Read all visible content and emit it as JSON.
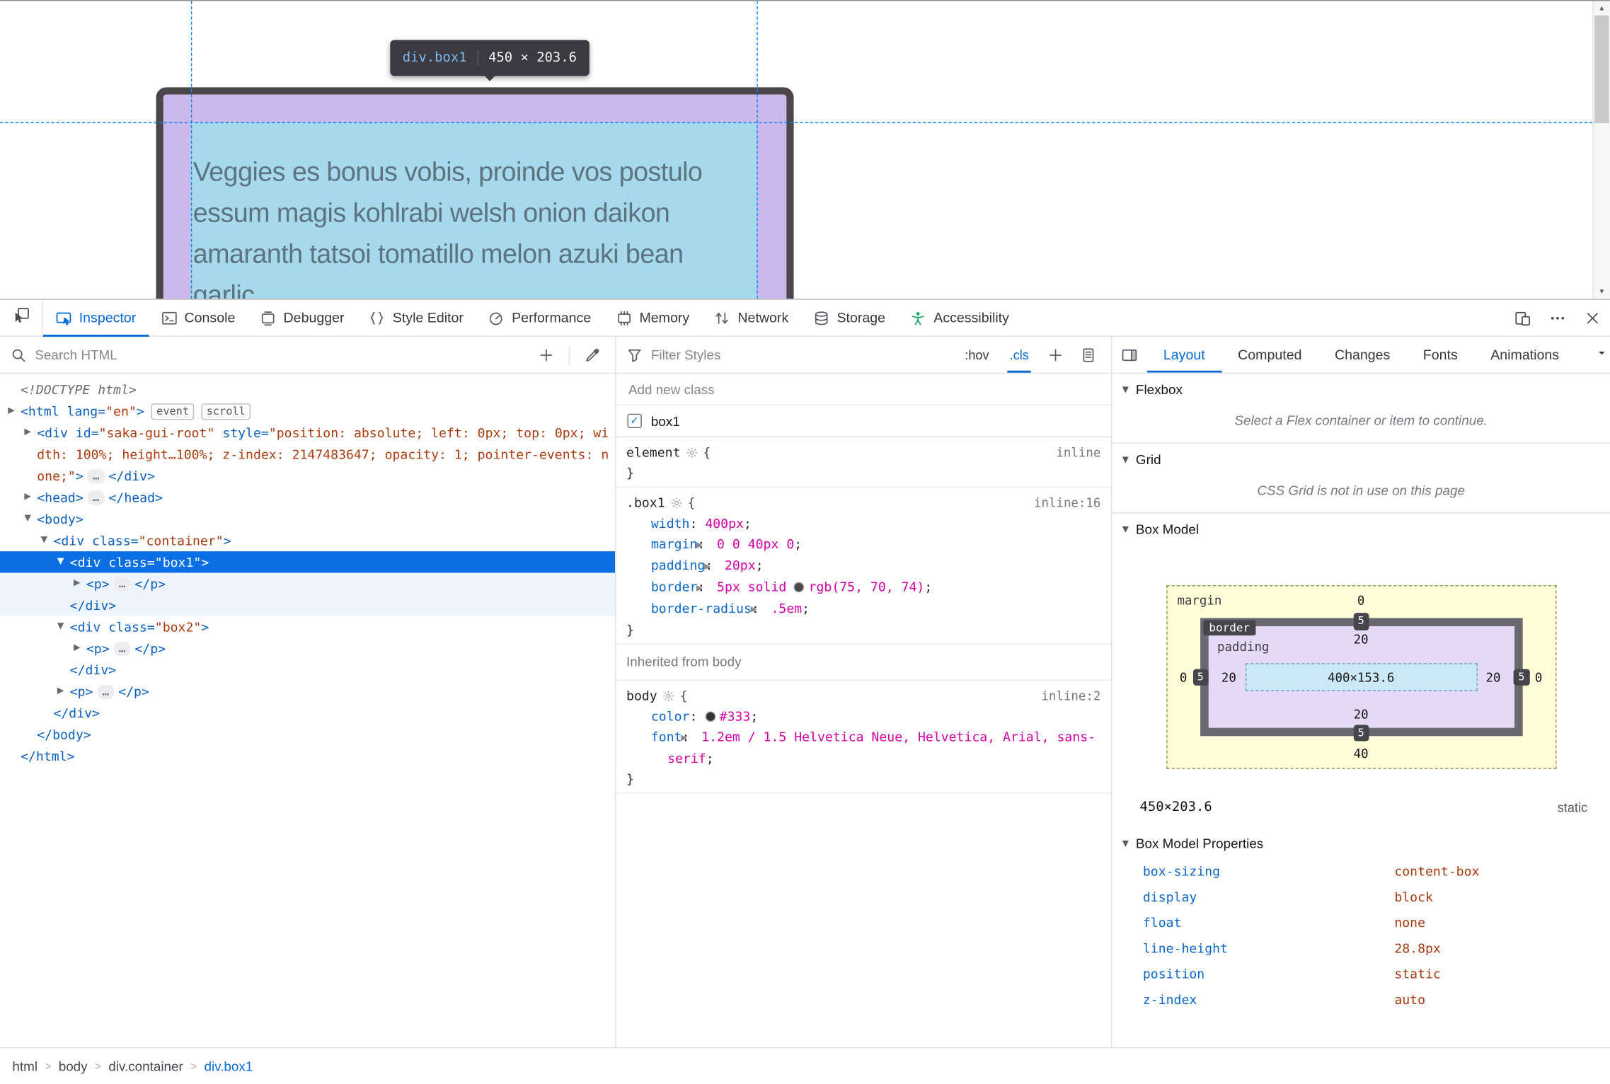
{
  "page_view": {
    "tooltip": {
      "selector": "div.box1",
      "dimensions": "450 × 203.6"
    },
    "box_text_lines": [
      "Veggies es bonus vobis, proinde vos postulo",
      "essum magis kohlrabi welsh onion daikon",
      "amaranth tatsoi tomatillo melon azuki bean",
      "garlic."
    ]
  },
  "devtools": {
    "tabs": [
      {
        "label": "Inspector",
        "icon": "inspector",
        "active": true
      },
      {
        "label": "Console",
        "icon": "console"
      },
      {
        "label": "Debugger",
        "icon": "debugger"
      },
      {
        "label": "Style Editor",
        "icon": "style-editor"
      },
      {
        "label": "Performance",
        "icon": "performance"
      },
      {
        "label": "Memory",
        "icon": "memory"
      },
      {
        "label": "Network",
        "icon": "network"
      },
      {
        "label": "Storage",
        "icon": "storage"
      },
      {
        "label": "Accessibility",
        "icon": "accessibility",
        "icon_color": "#12a457"
      }
    ],
    "controls": [
      {
        "icon": "responsive",
        "name": "responsive-design-mode-button"
      },
      {
        "icon": "meatball",
        "name": "devtools-menu-button"
      },
      {
        "icon": "close",
        "name": "close-devtools-button"
      }
    ],
    "accent_color": "#0768d9"
  },
  "markup": {
    "search_placeholder": "Search HTML",
    "lines": [
      {
        "indent": 0,
        "segments": [
          {
            "t": "doctype",
            "x": "<!DOCTYPE html>"
          }
        ]
      },
      {
        "indent": 0,
        "arrow": "right",
        "segments": [
          {
            "t": "tag",
            "x": "<html lang="
          },
          {
            "t": "val",
            "x": "\"en\""
          },
          {
            "t": "tag",
            "x": ">"
          },
          {
            "t": "badge",
            "x": "event"
          },
          {
            "t": "badge",
            "x": "scroll"
          }
        ]
      },
      {
        "indent": 1,
        "arrow": "right",
        "segments": [
          {
            "t": "tag",
            "x": "<div id="
          },
          {
            "t": "val",
            "x": "\"saka-gui-root\""
          },
          {
            "t": "tag",
            "x": " style="
          },
          {
            "t": "val",
            "x": "\"position: absolute; left: 0px; top: 0px; width: 100%; height…100%; z-index: 2147483647; opacity: 1; pointer-events: none;\""
          },
          {
            "t": "tag",
            "x": ">"
          },
          {
            "t": "ellipsis",
            "x": "…"
          },
          {
            "t": "tag",
            "x": "</div>"
          }
        ]
      },
      {
        "indent": 1,
        "arrow": "right",
        "segments": [
          {
            "t": "tag",
            "x": "<head>"
          },
          {
            "t": "ellipsis",
            "x": "…"
          },
          {
            "t": "tag",
            "x": "</head>"
          }
        ]
      },
      {
        "indent": 1,
        "arrow": "down",
        "segments": [
          {
            "t": "tag",
            "x": "<body>"
          }
        ]
      },
      {
        "indent": 2,
        "arrow": "down",
        "segments": [
          {
            "t": "tag",
            "x": "<div class="
          },
          {
            "t": "val",
            "x": "\"container\""
          },
          {
            "t": "tag",
            "x": ">"
          }
        ]
      },
      {
        "indent": 3,
        "arrow": "down",
        "selected": true,
        "segments": [
          {
            "t": "tag",
            "x": "<div class="
          },
          {
            "t": "val",
            "x": "\"box1\""
          },
          {
            "t": "tag",
            "x": ">"
          }
        ]
      },
      {
        "indent": 4,
        "arrow": "right",
        "tint": true,
        "segments": [
          {
            "t": "tag",
            "x": "<p>"
          },
          {
            "t": "ellipsis",
            "x": "…"
          },
          {
            "t": "tag",
            "x": "</p>"
          }
        ]
      },
      {
        "indent": 3,
        "tint": true,
        "segments": [
          {
            "t": "tag",
            "x": "</div>"
          }
        ]
      },
      {
        "indent": 3,
        "arrow": "down",
        "segments": [
          {
            "t": "tag",
            "x": "<div class="
          },
          {
            "t": "val",
            "x": "\"box2\""
          },
          {
            "t": "tag",
            "x": ">"
          }
        ]
      },
      {
        "indent": 4,
        "arrow": "right",
        "segments": [
          {
            "t": "tag",
            "x": "<p>"
          },
          {
            "t": "ellipsis",
            "x": "…"
          },
          {
            "t": "tag",
            "x": "</p>"
          }
        ]
      },
      {
        "indent": 3,
        "segments": [
          {
            "t": "tag",
            "x": "</div>"
          }
        ]
      },
      {
        "indent": 3,
        "arrow": "right",
        "segments": [
          {
            "t": "tag",
            "x": "<p>"
          },
          {
            "t": "ellipsis",
            "x": "…"
          },
          {
            "t": "tag",
            "x": "</p>"
          }
        ]
      },
      {
        "indent": 2,
        "segments": [
          {
            "t": "tag",
            "x": "</div>"
          }
        ]
      },
      {
        "indent": 1,
        "segments": [
          {
            "t": "tag",
            "x": "</body>"
          }
        ]
      },
      {
        "indent": 0,
        "segments": [
          {
            "t": "tag",
            "x": "</html>"
          }
        ]
      }
    ],
    "breadcrumbs": [
      {
        "label": "html"
      },
      {
        "label": "body"
      },
      {
        "label": "div.container"
      },
      {
        "label": "div.box1",
        "active": true
      }
    ]
  },
  "rules": {
    "filter_placeholder": "Filter Styles",
    "hov": ":hov",
    "cls": ".cls",
    "class_panel": {
      "add_placeholder": "Add new class",
      "classes": [
        {
          "name": "box1",
          "checked": true
        }
      ]
    },
    "sections": [
      {
        "type": "rule",
        "selector": "element",
        "location": "inline",
        "props": []
      },
      {
        "type": "rule",
        "selector": ".box1",
        "location": "inline:16",
        "props": [
          {
            "name": "width",
            "text": "400px"
          },
          {
            "name": "margin",
            "arrow": true,
            "text": "0 0 40px 0"
          },
          {
            "name": "padding",
            "arrow": true,
            "text": "20px"
          },
          {
            "name": "border",
            "arrow": true,
            "pre": "5px solid ",
            "swatch": "#4b464a",
            "text": "rgb(75, 70, 74)"
          },
          {
            "name": "border-radius",
            "arrow": true,
            "text": ".5em"
          }
        ]
      },
      {
        "type": "header",
        "text": "Inherited from body"
      },
      {
        "type": "rule",
        "selector": "body",
        "location": "inline:2",
        "props": [
          {
            "name": "color",
            "swatch": "#333333",
            "text": "#333"
          },
          {
            "name": "font",
            "arrow": true,
            "text": "1.2em / 1.5 Helvetica Neue, Helvetica, Arial, sans-serif"
          }
        ]
      }
    ]
  },
  "layout": {
    "tabs": [
      "Layout",
      "Computed",
      "Changes",
      "Fonts",
      "Animations"
    ],
    "flexbox": {
      "title": "Flexbox",
      "message": "Select a Flex container or item to continue."
    },
    "grid": {
      "title": "Grid",
      "message": "CSS Grid is not in use on this page"
    },
    "box_model": {
      "title": "Box Model",
      "labels": {
        "margin": "margin",
        "border": "border",
        "padding": "padding"
      },
      "content": "400×153.6",
      "margin": {
        "top": "0",
        "right": "0",
        "bottom": "40",
        "left": "0"
      },
      "border": {
        "top": "5",
        "right": "5",
        "bottom": "5",
        "left": "5"
      },
      "padding": {
        "top": "20",
        "right": "20",
        "bottom": "20",
        "left": "20"
      },
      "element_size": "450×203.6",
      "position": "static"
    },
    "properties": {
      "title": "Box Model Properties",
      "items": [
        {
          "name": "box-sizing",
          "value": "content-box"
        },
        {
          "name": "display",
          "value": "block"
        },
        {
          "name": "float",
          "value": "none"
        },
        {
          "name": "line-height",
          "value": "28.8px"
        },
        {
          "name": "position",
          "value": "static"
        },
        {
          "name": "z-index",
          "value": "auto"
        }
      ]
    }
  }
}
